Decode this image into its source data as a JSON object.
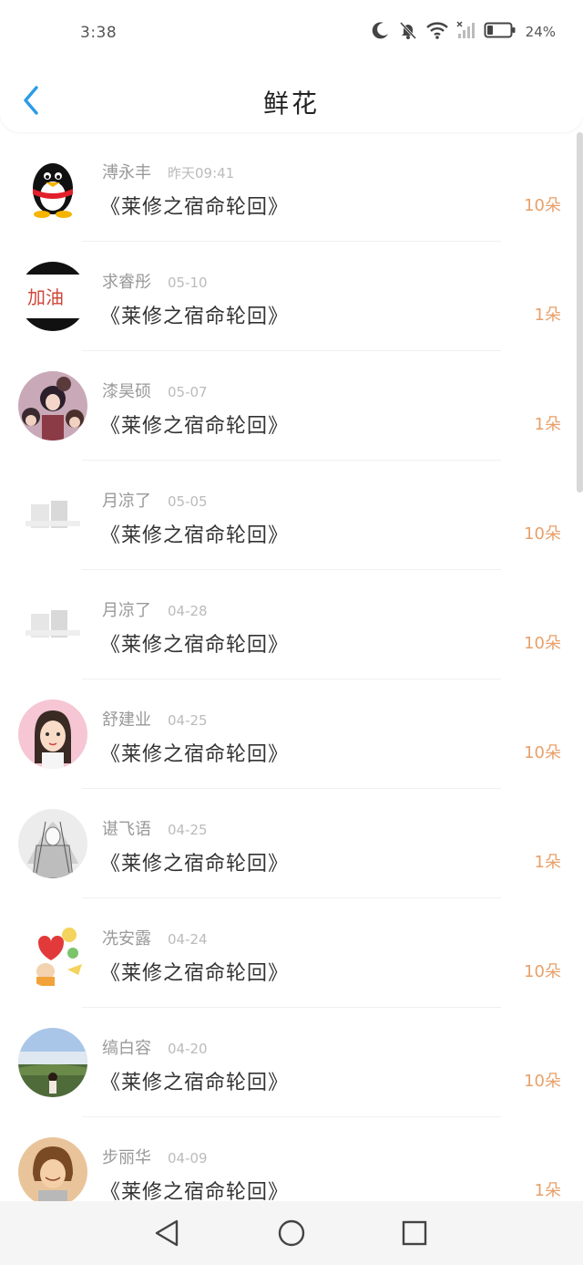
{
  "status_bar": {
    "time": "3:38",
    "battery": "24%",
    "icons": [
      "moon-icon",
      "bell-off-icon",
      "wifi-icon",
      "signal-icon",
      "battery-icon"
    ]
  },
  "header": {
    "title": "鲜花",
    "back_icon": "chevron-left-icon"
  },
  "colors": {
    "accent": "#2b9be8",
    "count": "#e8a06a"
  },
  "items": [
    {
      "name": "溥永丰",
      "date": "昨天09:41",
      "book": "《莱修之宿命轮回》",
      "count": "10朵",
      "avatar": "qq-penguin"
    },
    {
      "name": "求睿彤",
      "date": "05-10",
      "book": "《莱修之宿命轮回》",
      "count": "1朵",
      "avatar": "jiayou-badge"
    },
    {
      "name": "漆昊硕",
      "date": "05-07",
      "book": "《莱修之宿命轮回》",
      "count": "1朵",
      "avatar": "anime-group"
    },
    {
      "name": "月凉了",
      "date": "05-05",
      "book": "《莱修之宿命轮回》",
      "count": "10朵",
      "avatar": "faded-photo"
    },
    {
      "name": "月凉了",
      "date": "04-28",
      "book": "《莱修之宿命轮回》",
      "count": "10朵",
      "avatar": "faded-photo"
    },
    {
      "name": "舒建业",
      "date": "04-25",
      "book": "《莱修之宿命轮回》",
      "count": "10朵",
      "avatar": "cartoon-girl"
    },
    {
      "name": "谌飞语",
      "date": "04-25",
      "book": "《莱修之宿命轮回》",
      "count": "1朵",
      "avatar": "sketch-figure"
    },
    {
      "name": "冼安露",
      "date": "04-24",
      "book": "《莱修之宿命轮回》",
      "count": "10朵",
      "avatar": "heart-balloon"
    },
    {
      "name": "缟白容",
      "date": "04-20",
      "book": "《莱修之宿命轮回》",
      "count": "10朵",
      "avatar": "landscape-person"
    },
    {
      "name": "步丽华",
      "date": "04-09",
      "book": "《莱修之宿命轮回》",
      "count": "1朵",
      "avatar": "cartoon-boy"
    }
  ],
  "nav_bar": {
    "back": "triangle-back-icon",
    "home": "circle-home-icon",
    "recents": "square-recents-icon"
  }
}
